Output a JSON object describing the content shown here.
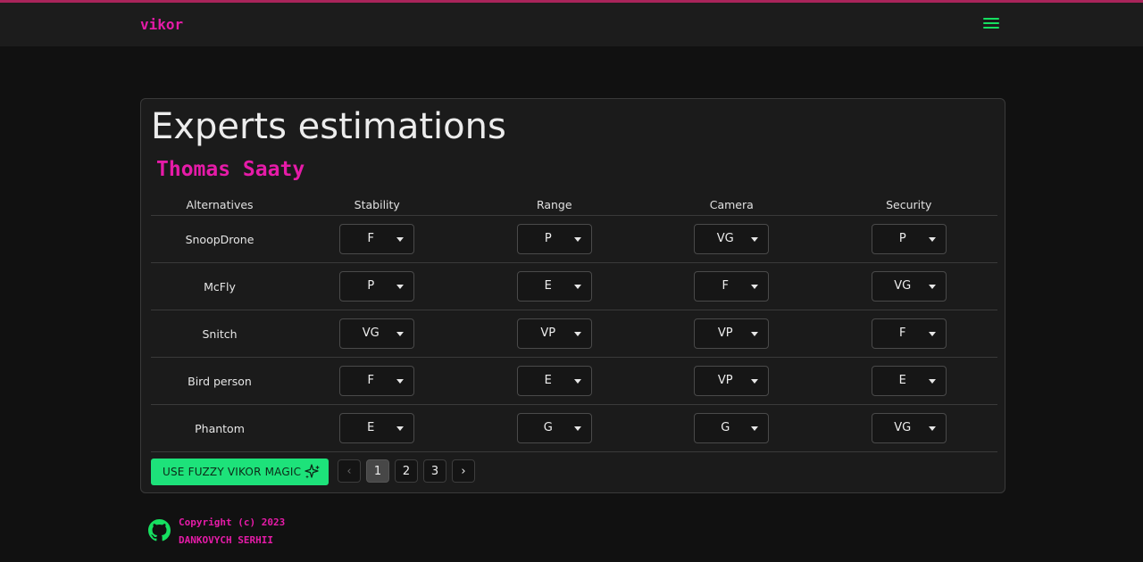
{
  "app": {
    "brand": "vikor"
  },
  "card": {
    "title": "Experts estimations",
    "expert_name": "Thomas Saaty",
    "columns": [
      "Alternatives",
      "Stability",
      "Range",
      "Camera",
      "Security"
    ],
    "rows": [
      {
        "name": "SnoopDrone",
        "values": [
          "F",
          "P",
          "VG",
          "P"
        ]
      },
      {
        "name": "McFly",
        "values": [
          "P",
          "E",
          "F",
          "VG"
        ]
      },
      {
        "name": "Snitch",
        "values": [
          "VG",
          "VP",
          "VP",
          "F"
        ]
      },
      {
        "name": "Bird person",
        "values": [
          "F",
          "E",
          "VP",
          "E"
        ]
      },
      {
        "name": "Phantom",
        "values": [
          "E",
          "G",
          "G",
          "VG"
        ]
      }
    ],
    "magic_button_label": "USE FUZZY VIKOR MAGIC",
    "pagination": {
      "prev": "‹",
      "pages": [
        "1",
        "2",
        "3"
      ],
      "next": "›",
      "current": "1"
    }
  },
  "footer": {
    "copyright": "Copyright (c) 2023",
    "author": "DANKOVYCH SERHII"
  },
  "colors": {
    "brand": "#e61ba8",
    "accent_green": "#1de27a",
    "top_border": "#a9245a"
  },
  "icons": {
    "menu": "hamburger-icon",
    "magic": "sparkles-icon",
    "footer": "github-icon"
  }
}
